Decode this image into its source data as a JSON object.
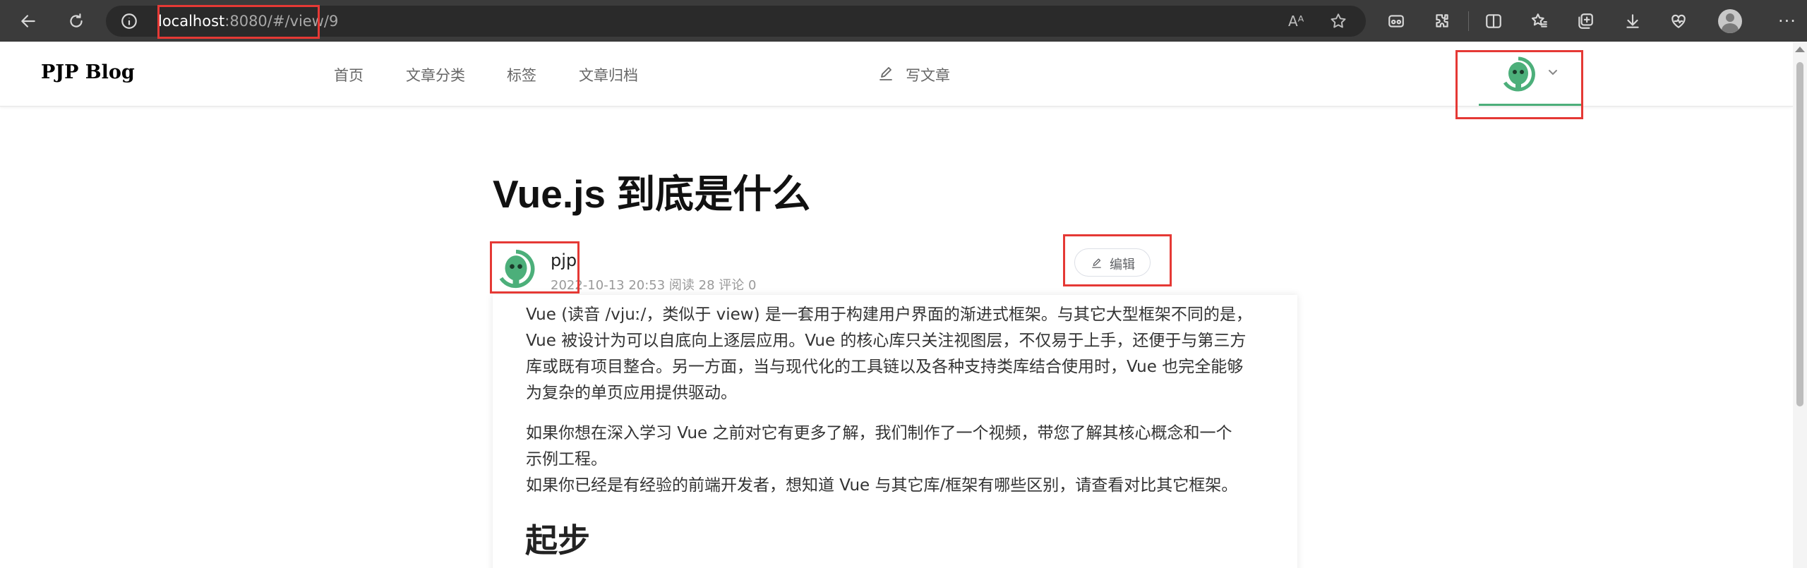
{
  "browser": {
    "url_host": "localhost",
    "url_rest": ":8080/#/view/9",
    "read_aloud_label": "Aᴬ",
    "menu_label": "···"
  },
  "site": {
    "logo": "PJP Blog",
    "nav": [
      "首页",
      "文章分类",
      "标签",
      "文章归档"
    ],
    "write_label": "写文章"
  },
  "article": {
    "title": "Vue.js 到底是什么",
    "author": "pjp",
    "meta": "2022-10-13 20:53 阅读 28 评论 0",
    "edit_label": "编辑",
    "paragraph1": [
      "Vue (读音 /vjuː/，类似于 view) 是一套用于构建用户界面的渐进式框架。与其它大型框架不同的是，",
      "Vue 被设计为可以自底向上逐层应用。Vue 的核心库只关注视图层，不仅易于上手，还便于与第三方",
      "库或既有项目整合。另一方面，当与现代化的工具链以及各种支持类库结合使用时，Vue 也完全能够",
      "为复杂的单页应用提供驱动。"
    ],
    "paragraph2": [
      "如果你想在深入学习 Vue 之前对它有更多了解，我们制作了一个视频，带您了解其核心概念和一个",
      "示例工程。",
      "如果你已经是有经验的前端开发者，想知道 Vue 与其它库/框架有哪些区别，请查看对比其它框架。"
    ],
    "section_heading": "起步"
  },
  "colors": {
    "chrome_bg": "#3b3b3b",
    "accent_green": "#4caf7a",
    "highlight_red": "#e53935"
  },
  "icons": {
    "back": "arrow-left-icon",
    "refresh": "refresh-icon",
    "site_info": "info-icon",
    "favorite": "star-icon",
    "extensions": "puzzle-icon",
    "split": "split-screen-icon",
    "favorites_list": "favorites-icon",
    "collections": "collections-icon",
    "downloads": "download-icon",
    "health": "heart-pulse-icon",
    "profile": "profile-icon",
    "write": "pen-icon",
    "avatar": "green-robot-avatar-icon"
  }
}
